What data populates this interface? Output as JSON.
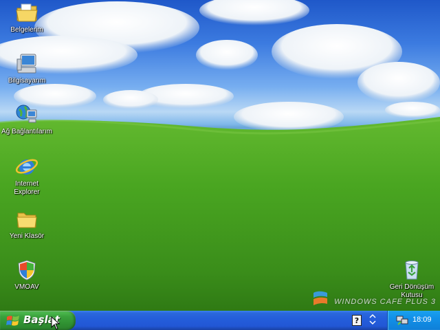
{
  "desktop": {
    "icons": [
      {
        "label": "Belgelerim",
        "icon": "my-documents-folder-icon"
      },
      {
        "label": "Bilgisayarım",
        "icon": "my-computer-icon"
      },
      {
        "label": "Ağ Bağlantılarım",
        "icon": "network-connections-icon"
      },
      {
        "label": "Internet\nExplorer",
        "icon": "internet-explorer-icon"
      },
      {
        "label": "Yeni Klasör",
        "icon": "folder-icon"
      },
      {
        "label": "VMOAV",
        "icon": "security-shield-icon"
      },
      {
        "label": "Geri Dönüşüm\nKutusu",
        "icon": "recycle-bin-icon"
      }
    ],
    "watermark": "WINDOWS CAFE PLUS 3"
  },
  "taskbar": {
    "start_label": "Başlat",
    "quick_help_icon": "help-icon",
    "clock": "18:09"
  },
  "colors": {
    "taskbar": "#245edb",
    "start_button": "#3aa13c",
    "tray": "#1290e8",
    "grass": "#4aa621",
    "sky": "#3c7be0"
  }
}
